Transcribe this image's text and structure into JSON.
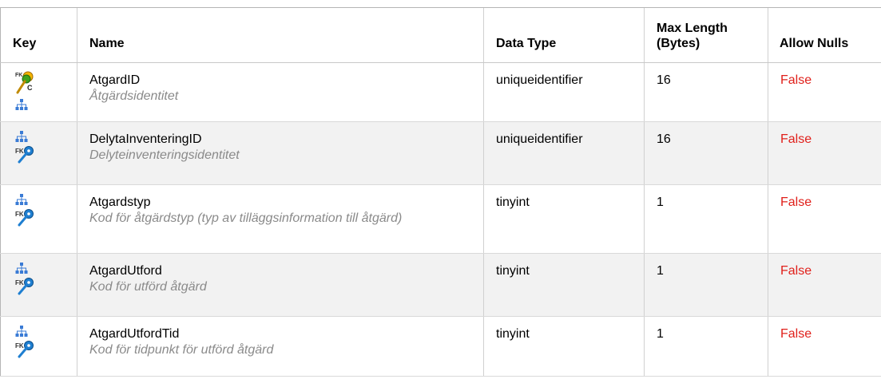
{
  "headers": {
    "key": "Key",
    "name": "Name",
    "data_type": "Data Type",
    "max_length_line1": "Max Length",
    "max_length_line2": "(Bytes)",
    "allow_nulls": "Allow Nulls"
  },
  "rows": [
    {
      "name": "AtgardID",
      "description": "Åtgärdsidentitet",
      "data_type": "uniqueidentifier",
      "max_length": "16",
      "allow_nulls": "False",
      "icons": [
        "primary-key-icon",
        "relationship-icon"
      ]
    },
    {
      "name": "DelytaInventeringID",
      "description": "Delyteinventeringsidentitet",
      "data_type": "uniqueidentifier",
      "max_length": "16",
      "allow_nulls": "False",
      "icons": [
        "relationship-icon",
        "foreign-key-icon"
      ]
    },
    {
      "name": "Atgardstyp",
      "description": "Kod för åtgärdstyp (typ av tilläggsinformation till åtgärd)",
      "data_type": "tinyint",
      "max_length": "1",
      "allow_nulls": "False",
      "icons": [
        "relationship-icon",
        "foreign-key-icon"
      ]
    },
    {
      "name": "AtgardUtford",
      "description": "Kod för utförd åtgärd",
      "data_type": "tinyint",
      "max_length": "1",
      "allow_nulls": "False",
      "icons": [
        "relationship-icon",
        "foreign-key-icon"
      ]
    },
    {
      "name": "AtgardUtfordTid",
      "description": "Kod för tidpunkt för utförd åtgärd",
      "data_type": "tinyint",
      "max_length": "1",
      "allow_nulls": "False",
      "icons": [
        "relationship-icon",
        "foreign-key-icon"
      ]
    }
  ],
  "colors": {
    "allow_nulls_false": "#e0201b",
    "description_text": "#8a8a8a",
    "alt_row_background": "#f2f2f2",
    "fk_key_blue": "#1f7fd1",
    "pk_key_green": "#3fa21c"
  }
}
